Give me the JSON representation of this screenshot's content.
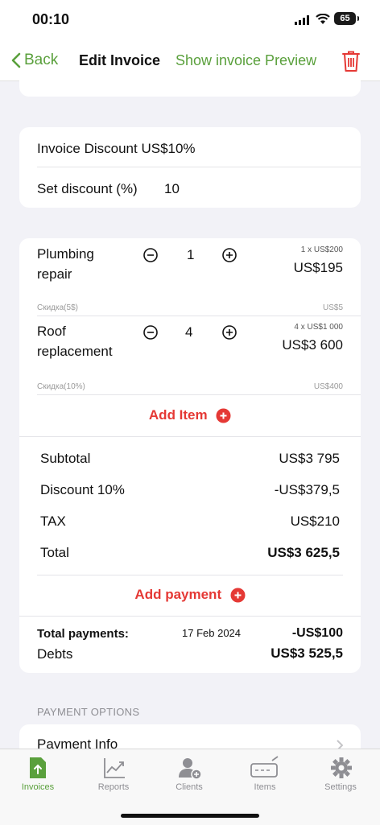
{
  "status": {
    "time": "00:10",
    "battery": "65"
  },
  "nav": {
    "back": "Back",
    "title": "Edit Invoice",
    "preview": "Show invoice Preview"
  },
  "discount_card": {
    "invoice_discount": "Invoice Discount US$10%",
    "set_discount_label": "Set discount (%)",
    "set_discount_value": "10"
  },
  "items": [
    {
      "name_line1": "Plumbing",
      "name_line2": "repair",
      "qty": "1",
      "unit": "1 x  US$200",
      "total": "US$195",
      "discount_label": "Скидка(5$)",
      "discount_value": "US$5"
    },
    {
      "name_line1": "Roof",
      "name_line2": "replacement",
      "qty": "4",
      "unit": "4 x  US$1 000",
      "total": "US$3 600",
      "discount_label": "Скидка(10%)",
      "discount_value": "US$400"
    }
  ],
  "add_item": "Add Item",
  "summary": {
    "subtotal_label": "Subtotal",
    "subtotal_value": "US$3 795",
    "discount_label": "Discount 10%",
    "discount_value": "-US$379,5",
    "tax_label": "TAX",
    "tax_value": "US$210",
    "total_label": "Total",
    "total_value": "US$3 625,5"
  },
  "add_payment": "Add payment",
  "payments": {
    "label": "Total payments:",
    "date": "17 Feb 2024",
    "value": "-US$100",
    "debts_label": "Debts",
    "debts_value": "US$3 525,5"
  },
  "payment_options": {
    "header": "PAYMENT OPTIONS",
    "row": "Payment Info"
  },
  "tabs": [
    {
      "label": "Invoices",
      "icon": "invoice-file-icon"
    },
    {
      "label": "Reports",
      "icon": "chart-icon"
    },
    {
      "label": "Clients",
      "icon": "add-client-icon"
    },
    {
      "label": "Items",
      "icon": "ticket-icon"
    },
    {
      "label": "Settings",
      "icon": "gear-icon"
    }
  ],
  "colors": {
    "accent": "#5aa03c",
    "red": "#e53935"
  }
}
